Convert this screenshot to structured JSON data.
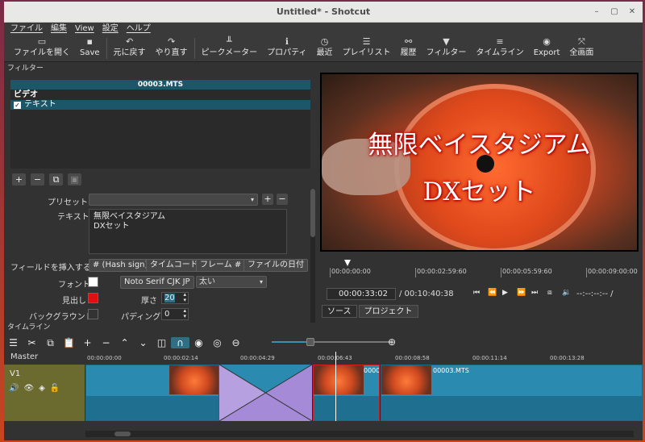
{
  "window": {
    "title": "Untitled* - Shotcut"
  },
  "menu": [
    "ファイル",
    "編集",
    "View",
    "設定",
    "ヘルプ"
  ],
  "toolbar": [
    {
      "label": "ファイルを開く",
      "icon": "open-folder-icon",
      "glyph": "▭"
    },
    {
      "label": "Save",
      "icon": "save-icon",
      "glyph": "▪"
    },
    {
      "label": "元に戻す",
      "icon": "undo-icon",
      "glyph": "↶"
    },
    {
      "label": "やり直す",
      "icon": "redo-icon",
      "glyph": "↷"
    },
    {
      "label": "ピークメーター",
      "icon": "peak-meter-icon",
      "glyph": "╨"
    },
    {
      "label": "プロパティ",
      "icon": "info-icon",
      "glyph": "ℹ"
    },
    {
      "label": "最近",
      "icon": "clock-icon",
      "glyph": "◷"
    },
    {
      "label": "プレイリスト",
      "icon": "list-icon",
      "glyph": "☰"
    },
    {
      "label": "履歴",
      "icon": "history-icon",
      "glyph": "⚯"
    },
    {
      "label": "フィルター",
      "icon": "filter-icon",
      "glyph": "▼"
    },
    {
      "label": "タイムライン",
      "icon": "timeline-icon",
      "glyph": "≡"
    },
    {
      "label": "Export",
      "icon": "export-icon",
      "glyph": "◉"
    },
    {
      "label": "全画面",
      "icon": "fullscreen-icon",
      "glyph": "⤧"
    }
  ],
  "filters": {
    "header": "フィルター",
    "clip_name": "00003.MTS",
    "category": "ビデオ",
    "item": "テキスト",
    "preset_label": "プリセット",
    "text_label": "テキスト",
    "text_value": "無限ベイスタジアム\nDXセット",
    "insert_field_label": "フィールドを挿入する",
    "insert_buttons": [
      "# (Hash sign)",
      "タイムコード",
      "フレーム #",
      "ファイルの日付"
    ],
    "font_label": "フォント",
    "font_name": "Noto Serif CJK JP",
    "font_weight": "太い",
    "outline_label": "見出し",
    "thickness_label": "厚さ",
    "thickness_value": "20",
    "background_label": "バックグラウンド",
    "padding_label": "パディング",
    "padding_value": "0",
    "colors": {
      "font": "#ffffff",
      "outline": "#e01010",
      "background": "#333333"
    }
  },
  "viewer": {
    "overlay_line1": "無限ベイスタジアム",
    "overlay_line2": "DXセット",
    "ruler": [
      "00:00:00:00",
      "00:00:02:59:60",
      "00:00:05:59:60",
      "00:00:09:00:00"
    ],
    "position": "00:00:33:02",
    "duration": "/ 00:10:40:38",
    "in_out": "--:--:--:-- /",
    "tabs": [
      "ソース",
      "プロジェクト"
    ]
  },
  "timeline": {
    "header": "タイムライン",
    "master": "Master",
    "track": "V1",
    "ticks": [
      "00:00:00:00",
      "00:00:02:14",
      "00:00:04:29",
      "00:00:06:43",
      "00:00:08:58",
      "00:00:11:14",
      "00:00:13:28"
    ],
    "clip_labels": [
      "00003",
      "00003.MTS"
    ]
  }
}
